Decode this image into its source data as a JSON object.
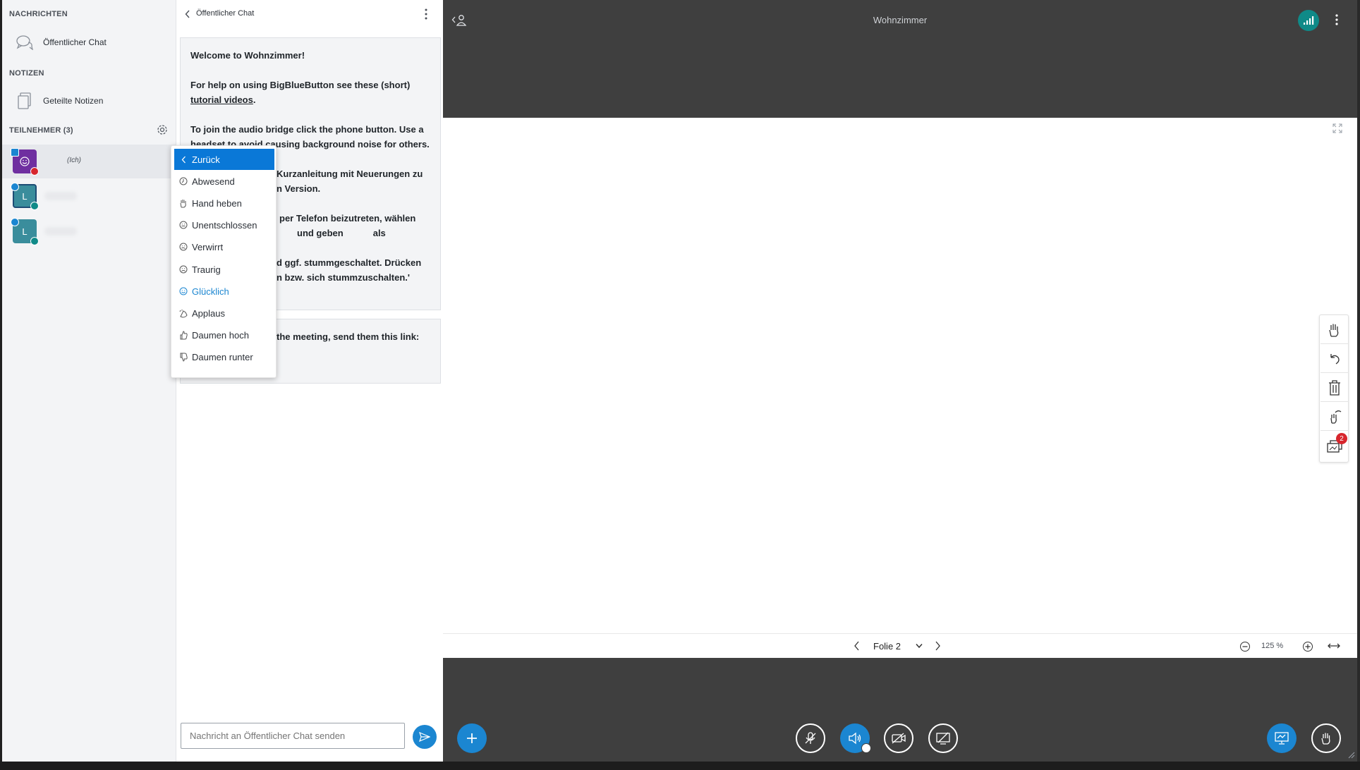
{
  "left_panel": {
    "messages_title": "NACHRICHTEN",
    "public_chat": "Öffentlicher Chat",
    "notes_title": "NOTIZEN",
    "shared_notes": "Geteilte Notizen",
    "participants_title": "TEILNEHMER (3)",
    "users": [
      {
        "initial": "",
        "name": "(Ich)",
        "color": "#6f2fa0"
      },
      {
        "initial": "L",
        "name": "",
        "color": "#3a8d9c"
      },
      {
        "initial": "L",
        "name": "",
        "color": "#3a8d9c"
      }
    ]
  },
  "chat": {
    "title": "Öffentlicher Chat",
    "welcome_prefix": "Welcome to ",
    "room_bold": "Wohnzimmer",
    "welcome_suffix": "!",
    "help_text": "For help on using BigBlueButton see these (short) ",
    "help_link": "tutorial videos",
    "help_end": ".",
    "audio_line1": "To join the audio bridge click the phone button. Use a",
    "audio_line2": "headset to avoid causing background noise for others.",
    "kurz_line1": "Kurzanleitung mit Neuerungen zu",
    "kurz_line2": "n Version.",
    "phone_line1": "per Telefon beizutreten, wählen",
    "phone_line2a": "und geben",
    "phone_line2b": "als",
    "mute_line1": "d ggf. stummgeschaltet. Drücken",
    "mute_line2": "n bzw. sich stummzuschalten.'",
    "invite_line": "the meeting, send them this link:",
    "input_placeholder": "Nachricht an Öffentlicher Chat senden"
  },
  "status_menu": {
    "items": [
      {
        "label": "Zurück",
        "icon": "chevron-left-icon"
      },
      {
        "label": "Abwesend",
        "icon": "clock-icon"
      },
      {
        "label": "Hand heben",
        "icon": "hand-icon"
      },
      {
        "label": "Unentschlossen",
        "icon": "neutral-face-icon"
      },
      {
        "label": "Verwirrt",
        "icon": "confused-face-icon"
      },
      {
        "label": "Traurig",
        "icon": "sad-face-icon"
      },
      {
        "label": "Glücklich",
        "icon": "happy-face-icon"
      },
      {
        "label": "Applaus",
        "icon": "applause-icon"
      },
      {
        "label": "Daumen hoch",
        "icon": "thumbs-up-icon"
      },
      {
        "label": "Daumen runter",
        "icon": "thumbs-down-icon"
      }
    ],
    "active_index": 0,
    "selected_index": 6
  },
  "presentation": {
    "room_name": "Wohnzimmer",
    "slide_label": "Folie 2",
    "zoom": "125 %",
    "tool_badge": "2"
  },
  "colors": {
    "accent": "#1b86d1",
    "dark_bg": "#3f3f3f",
    "connection": "#0f8a88",
    "badge": "#d7262d"
  }
}
